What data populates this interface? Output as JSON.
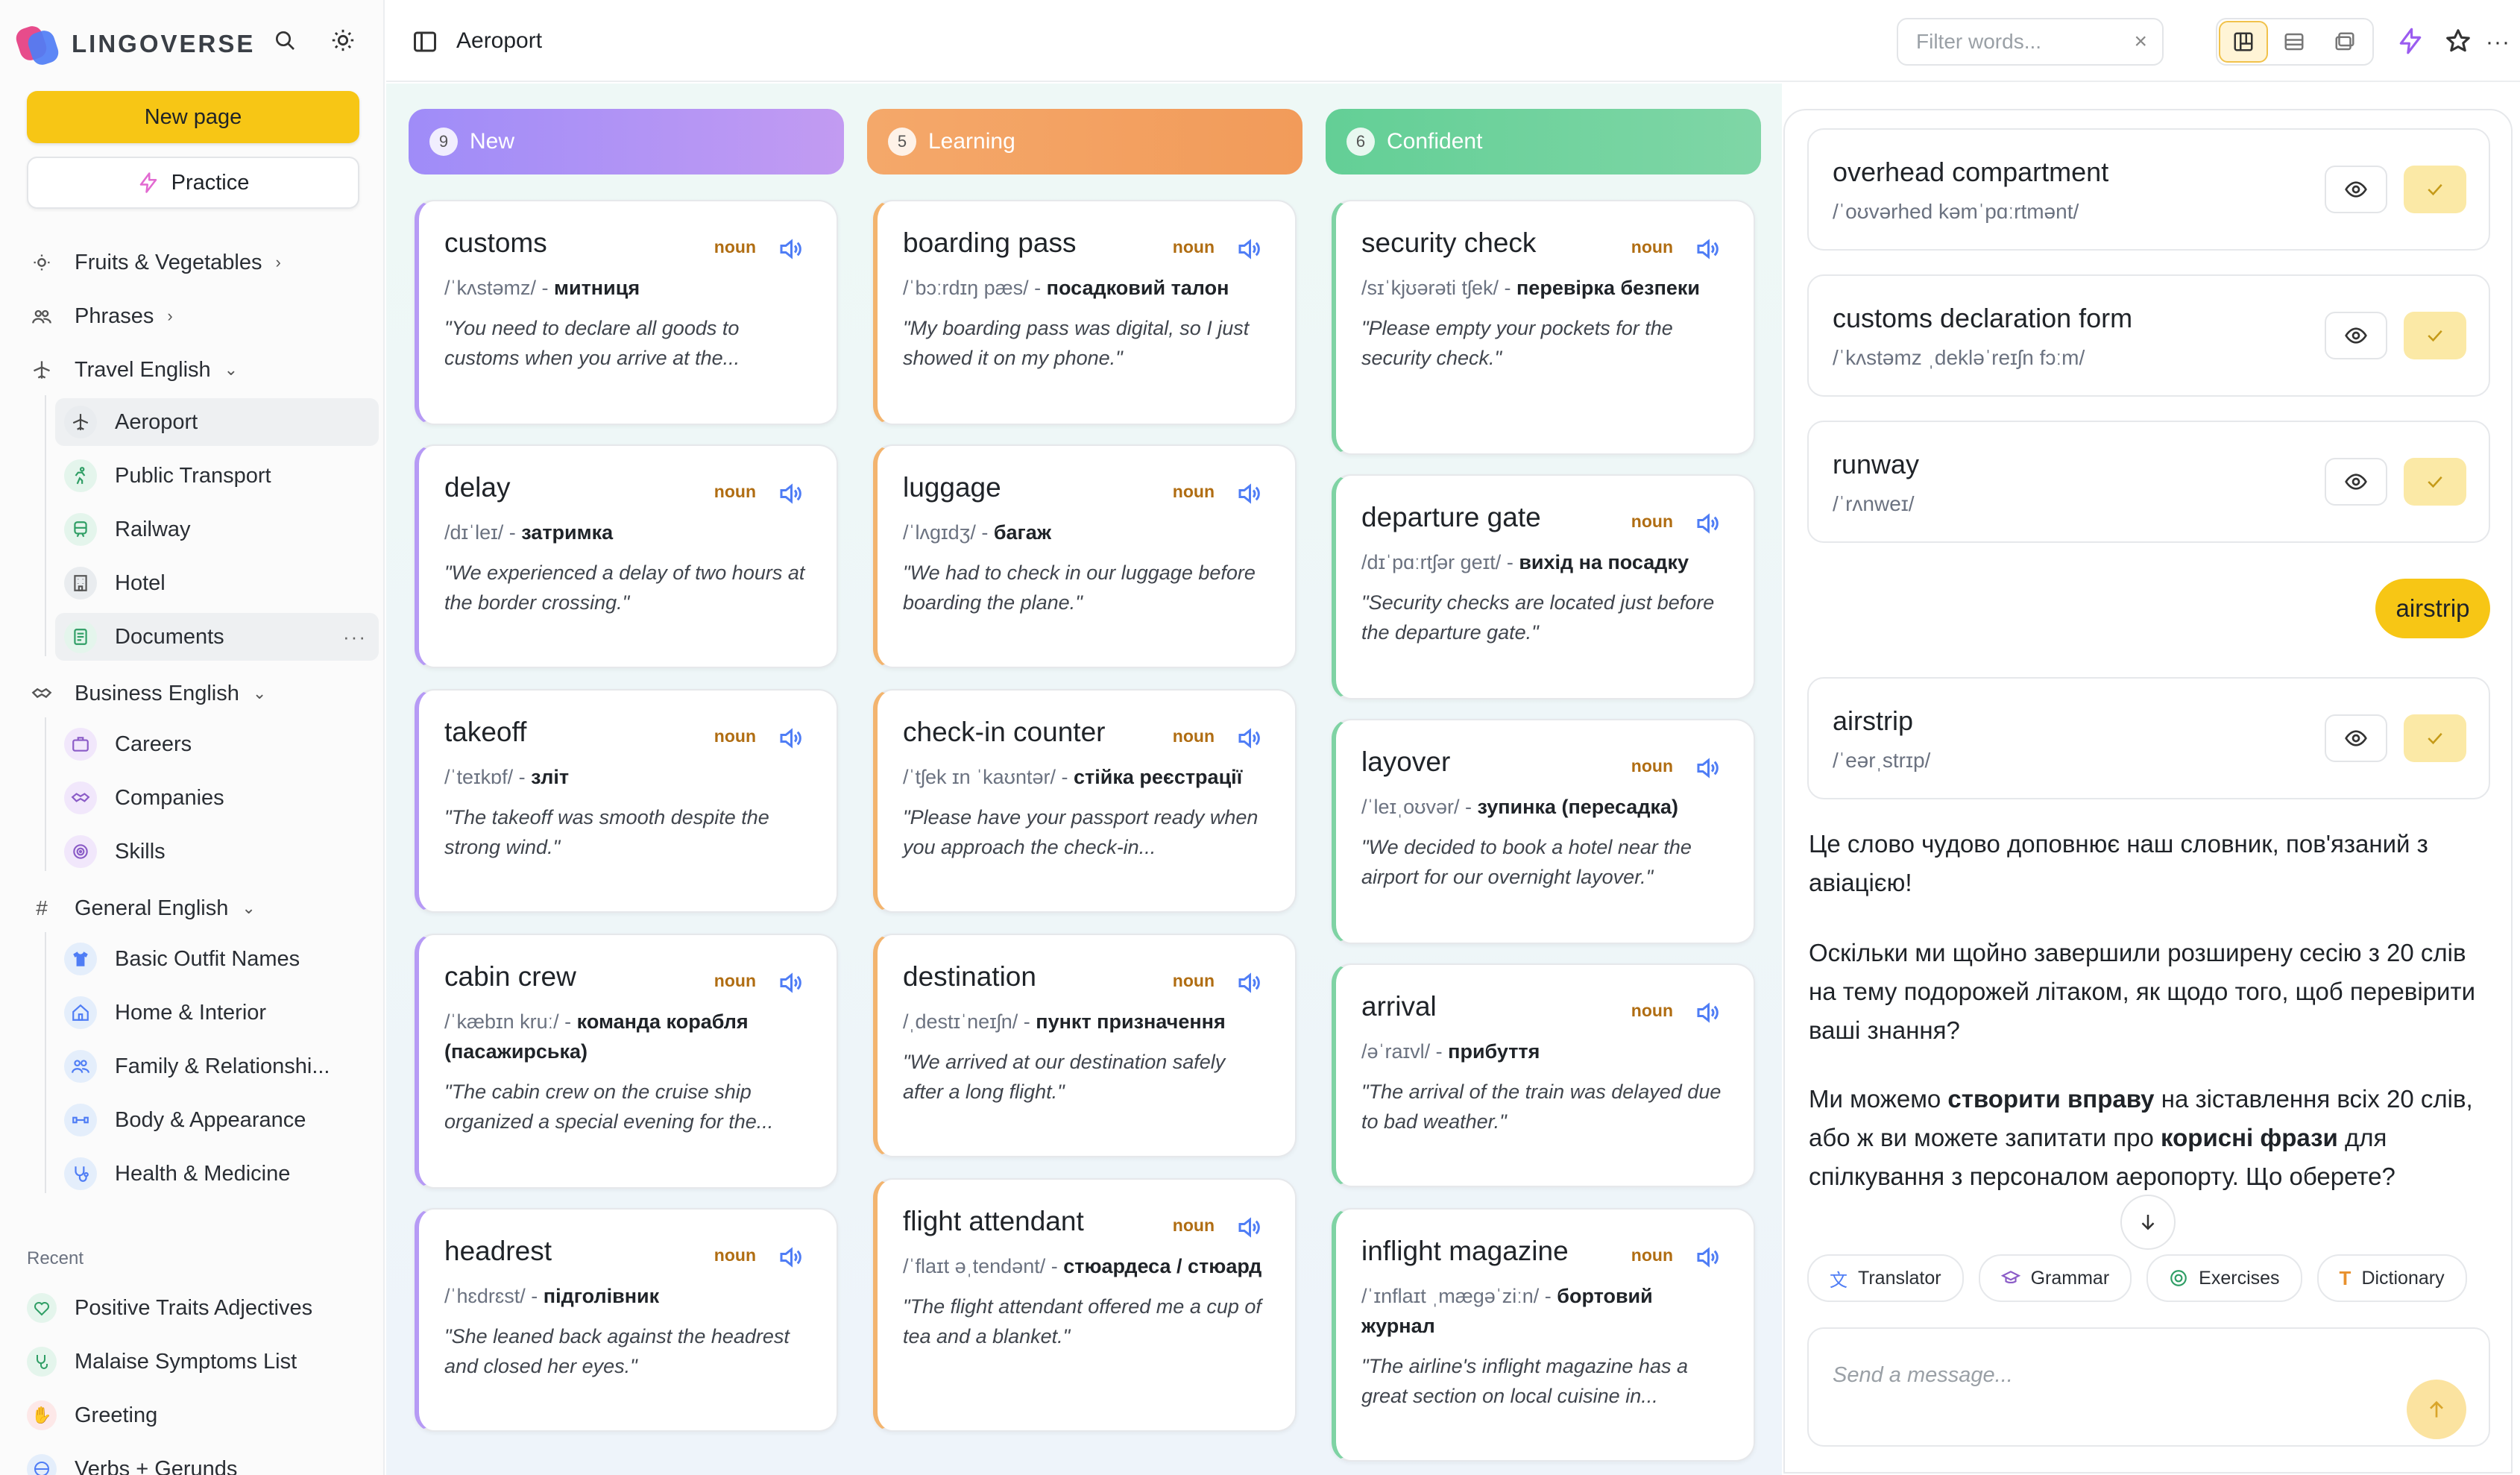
{
  "brand": {
    "name": "LINGOVERSE"
  },
  "sidebar": {
    "new_page": "New page",
    "practice": "Practice",
    "nav": [
      {
        "label": "Fruits & Vegetables",
        "icon": "sun-icon"
      },
      {
        "label": "Phrases",
        "icon": "chat-icon"
      },
      {
        "label": "Travel English",
        "icon": "plane-icon"
      },
      {
        "label": "Business English",
        "icon": "handshake-icon"
      },
      {
        "label": "General English",
        "icon": "hash-icon"
      }
    ],
    "travel_items": [
      {
        "label": "Aeroport",
        "icon": "plane-icon"
      },
      {
        "label": "Public Transport",
        "icon": "runner-icon"
      },
      {
        "label": "Railway",
        "icon": "train-icon"
      },
      {
        "label": "Hotel",
        "icon": "building-icon"
      },
      {
        "label": "Documents",
        "icon": "document-icon"
      }
    ],
    "business_items": [
      {
        "label": "Careers",
        "icon": "briefcase-icon"
      },
      {
        "label": "Companies",
        "icon": "handshake-icon"
      },
      {
        "label": "Skills",
        "icon": "target-icon"
      }
    ],
    "general_items": [
      {
        "label": "Basic Outfit Names",
        "icon": "shirt-icon"
      },
      {
        "label": "Home & Interior",
        "icon": "home-icon"
      },
      {
        "label": "Family & Relationshi...",
        "icon": "people-icon"
      },
      {
        "label": "Body & Appearance",
        "icon": "body-icon"
      },
      {
        "label": "Health & Medicine",
        "icon": "stethoscope-icon"
      }
    ],
    "recent_label": "Recent",
    "recent": [
      {
        "label": "Positive Traits Adjectives",
        "icon": "heart-icon"
      },
      {
        "label": "Malaise Symptoms List",
        "icon": "stethoscope-icon"
      },
      {
        "label": "Greeting",
        "icon": "wave-icon"
      },
      {
        "label": "Verbs + Gerunds",
        "icon": "globe-icon"
      }
    ]
  },
  "topbar": {
    "title": "Aeroport",
    "filter_placeholder": "Filter words..."
  },
  "columns": [
    {
      "key": "new",
      "label": "New",
      "count": "9",
      "color": "#a78bfa"
    },
    {
      "key": "learning",
      "label": "Learning",
      "count": "5",
      "color": "#f4a45f"
    },
    {
      "key": "confident",
      "label": "Confident",
      "count": "6",
      "color": "#6fcf97"
    }
  ],
  "cards": {
    "new": [
      {
        "word": "customs",
        "pos": "noun",
        "phon": "/ˈkʌstəmz/",
        "trans": "митниця",
        "ex": "\"You need to declare all goods to customs when you arrive at the..."
      },
      {
        "word": "delay",
        "pos": "noun",
        "phon": "/dɪˈleɪ/",
        "trans": "затримка",
        "ex": "\"We experienced a delay of two hours at the border crossing.\""
      },
      {
        "word": "takeoff",
        "pos": "noun",
        "phon": "/ˈteɪkɒf/",
        "trans": "зліт",
        "ex": "\"The takeoff was smooth despite the strong wind.\""
      },
      {
        "word": "cabin crew",
        "pos": "noun",
        "phon": "/ˈkæbɪn kruː/",
        "trans": "команда корабля (пасажирська)",
        "ex": "\"The cabin crew on the cruise ship organized a special evening for the..."
      },
      {
        "word": "headrest",
        "pos": "noun",
        "phon": "/ˈhɛdrɛst/",
        "trans": "підголівник",
        "ex": "\"She leaned back against the headrest and closed her eyes.\""
      }
    ],
    "learning": [
      {
        "word": "boarding pass",
        "pos": "noun",
        "phon": "/ˈbɔːrdɪŋ pæs/",
        "trans": "посадковий талон",
        "ex": "\"My boarding pass was digital, so I just showed it on my phone.\""
      },
      {
        "word": "luggage",
        "pos": "noun",
        "phon": "/ˈlʌɡɪdʒ/",
        "trans": "багаж",
        "ex": "\"We had to check in our luggage before boarding the plane.\""
      },
      {
        "word": "check-in counter",
        "pos": "noun",
        "phon": "/ˈtʃek ɪn ˈkaʊntər/",
        "trans": "стійка реєстрації",
        "ex": "\"Please have your passport ready when you approach the check-in..."
      },
      {
        "word": "destination",
        "pos": "noun",
        "phon": "/ˌdestɪˈneɪʃn/",
        "trans": "пункт призначення",
        "ex": "\"We arrived at our destination safely after a long flight.\""
      },
      {
        "word": "flight attendant",
        "pos": "noun",
        "phon": "/ˈflaɪt əˌtendənt/",
        "trans": "стюардеса / стюард",
        "ex": "\"The flight attendant offered me a cup of tea and a blanket.\""
      }
    ],
    "confident": [
      {
        "word": "security check",
        "pos": "noun",
        "phon": "/sɪˈkjʊərəti tʃek/",
        "trans": "перевірка безпеки",
        "ex": "\"Please empty your pockets for the security check.\""
      },
      {
        "word": "departure gate",
        "pos": "noun",
        "phon": "/dɪˈpɑːrtʃər ɡeɪt/",
        "trans": "вихід на посадку",
        "ex": "\"Security checks are located just before the departure gate.\""
      },
      {
        "word": "layover",
        "pos": "noun",
        "phon": "/ˈleɪˌoʊvər/",
        "trans": "зупинка (пересадка)",
        "ex": "\"We decided to book a hotel near the airport for our overnight layover.\""
      },
      {
        "word": "arrival",
        "pos": "noun",
        "phon": "/əˈraɪvl/",
        "trans": "прибуття",
        "ex": "\"The arrival of the train was delayed due to bad weather.\""
      },
      {
        "word": "inflight magazine",
        "pos": "noun",
        "phon": "/ˈɪnflaɪt ˌmæɡəˈziːn/",
        "trans": "бортовий журнал",
        "ex": "\"The airline's inflight magazine has a great section on local cuisine in..."
      }
    ]
  },
  "chat": {
    "word_cards": [
      {
        "word": "overhead compartment",
        "phon": "/ˈoʊvərhed kəmˈpɑːrtmənt/"
      },
      {
        "word": "customs declaration form",
        "phon": "/ˈkʌstəmz ˌdekləˈreɪʃn fɔːm/"
      },
      {
        "word": "runway",
        "phon": "/ˈrʌnweɪ/"
      }
    ],
    "user_bubble": "airstrip",
    "answer_card": {
      "word": "airstrip",
      "phon": "/ˈeərˌstrɪp/"
    },
    "msg1": "Це слово чудово доповнює наш словник, пов'язаний з авіацією!",
    "msg2": "Оскільки ми щойно завершили розширену сесію з 20 слів на тему подорожей літаком, як щодо того, щоб перевірити ваші знання?",
    "msg3_a": "Ми можемо ",
    "msg3_b": "створити вправу",
    "msg3_c": " на зіставлення всіх 20 слів, або ж ви можете запитати про ",
    "msg3_d": "корисні фрази",
    "msg3_e": " для спілкування з персоналом аеропорту. Що оберете?",
    "tools": [
      {
        "label": "Translator",
        "icon": "translate-icon"
      },
      {
        "label": "Grammar",
        "icon": "grammar-icon"
      },
      {
        "label": "Exercises",
        "icon": "exercises-icon"
      },
      {
        "label": "Dictionary",
        "icon": "dictionary-icon"
      }
    ],
    "composer_placeholder": "Send a message..."
  },
  "colors": {
    "accent": "#f7c615",
    "new": "#a78bfa",
    "learning": "#f4a45f",
    "confident": "#6fcf97",
    "pos": "#b06d12",
    "speaker": "#4f7df5"
  }
}
